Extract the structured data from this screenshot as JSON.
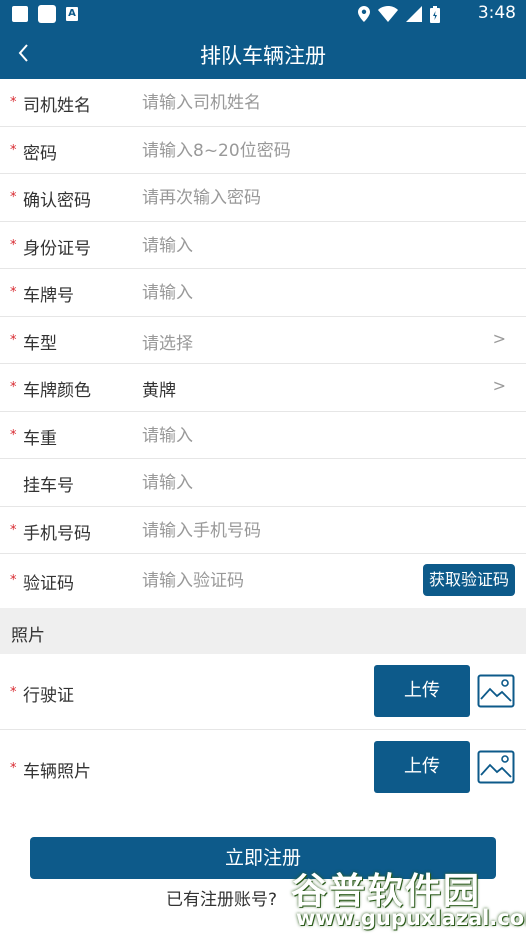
{
  "status_bar": {
    "time": "3:48",
    "icons": [
      "notification-square-icon",
      "photo-icon",
      "a-icon",
      "location-icon",
      "wifi-icon",
      "signal-icon",
      "battery-icon"
    ]
  },
  "app_bar": {
    "title": "排队车辆注册",
    "back_icon": "chevron-left-icon"
  },
  "form": {
    "rows": [
      {
        "label": "司机姓名",
        "required": true,
        "placeholder": "请输入司机姓名",
        "value": ""
      },
      {
        "label": "密码",
        "required": true,
        "placeholder": "请输入8~20位密码",
        "value": ""
      },
      {
        "label": "确认密码",
        "required": true,
        "placeholder": "请再次输入密码",
        "value": ""
      },
      {
        "label": "身份证号",
        "required": true,
        "placeholder": "请输入",
        "value": ""
      },
      {
        "label": "车牌号",
        "required": true,
        "placeholder": "请输入",
        "value": ""
      },
      {
        "label": "车型",
        "required": true,
        "placeholder": "请选择",
        "value": "",
        "chevron": ">"
      },
      {
        "label": "车牌颜色",
        "required": true,
        "placeholder": "",
        "value": "黄牌",
        "chevron": ">"
      },
      {
        "label": "车重",
        "required": true,
        "placeholder": "请输入",
        "value": ""
      },
      {
        "label": "挂车号",
        "required": false,
        "placeholder": "请输入",
        "value": ""
      },
      {
        "label": "手机号码",
        "required": true,
        "placeholder": "请输入手机号码",
        "value": ""
      },
      {
        "label": "验证码",
        "required": true,
        "placeholder": "请输入验证码",
        "value": "",
        "button": "获取验证码"
      }
    ],
    "required_mark": "*"
  },
  "photos": {
    "section_title": "照片",
    "rows": [
      {
        "label": "行驶证",
        "upload_label": "上传",
        "icon": "image-icon"
      },
      {
        "label": "车辆照片",
        "upload_label": "上传",
        "icon": "image-icon"
      }
    ]
  },
  "footer": {
    "submit_label": "立即注册",
    "login_prompt": "已有注册账号?"
  },
  "watermark": {
    "title": "谷普软件园",
    "url": "www.gupuxlazal.com"
  },
  "colors": {
    "primary": "#0d5a8a",
    "required": "#d8282f",
    "placeholder": "#999999",
    "section_bg": "#efefef"
  }
}
